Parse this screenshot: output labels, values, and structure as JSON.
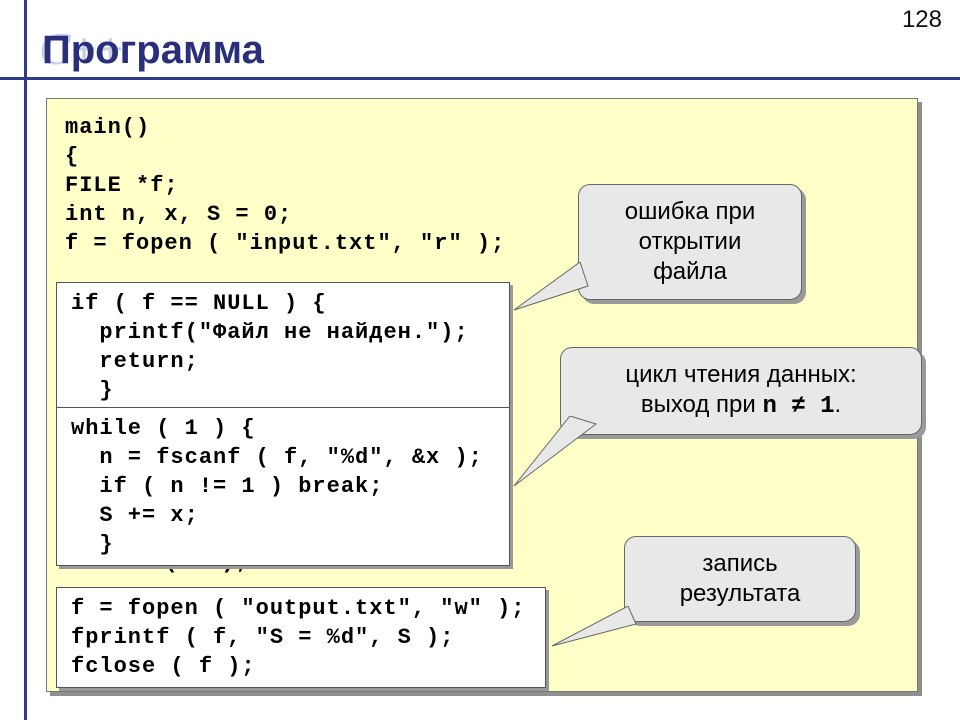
{
  "page_number": "128",
  "watermark": "C++",
  "title": "Программа",
  "code_main": "main()\n{\nFILE *f;\nint n, x, S = 0;\nf = fopen ( \"input.txt\", \"r\" );\n\n\n\n\n\n\n\n\n\n\nfclose ( f );\n\n\n\n}",
  "code_box1": "if ( f == NULL ) {\n  printf(\"Файл не найден.\");\n  return;\n  }",
  "code_box2": "while ( 1 ) {\n  n = fscanf ( f, \"%d\", &x );\n  if ( n != 1 ) break;\n  S += x;\n  }",
  "code_box3": "f = fopen ( \"output.txt\", \"w\" );\nfprintf ( f, \"S = %d\", S );\nfclose ( f );",
  "callout1": "ошибка при открытии файла",
  "callout2_a": "цикл чтения данных:",
  "callout2_b1": "выход при ",
  "callout2_b2": "n ≠ 1",
  "callout2_b3": ".",
  "callout3": "запись результата"
}
